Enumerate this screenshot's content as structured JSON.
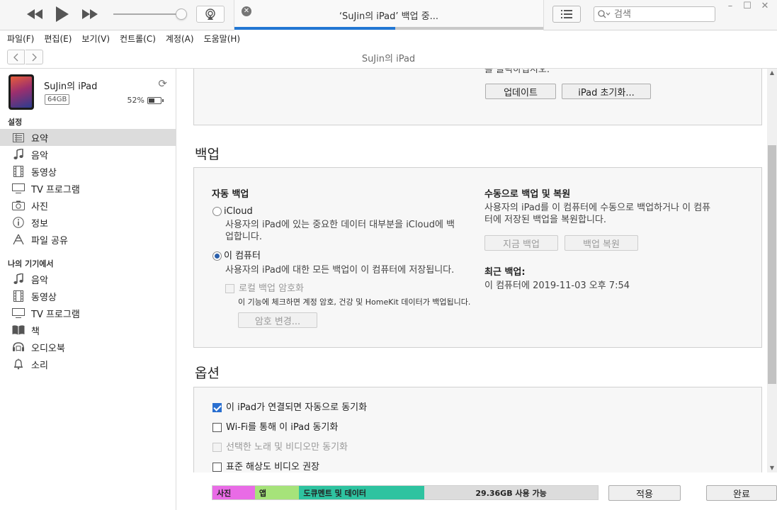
{
  "player": {
    "lcd_title": "‘SuJin의 iPad’ 백업 중...",
    "progress": 0.52,
    "search_placeholder": "검색"
  },
  "window_controls": {
    "minimize": "–",
    "maximize": "☐",
    "close": "✕"
  },
  "menubar": [
    "파일(F)",
    "편집(E)",
    "보기(V)",
    "컨트롤(C)",
    "계정(A)",
    "도움말(H)"
  ],
  "nav": {
    "device_title": "SuJin의 iPad"
  },
  "device": {
    "name": "SuJin의 iPad",
    "capacity": "64GB",
    "battery": "52%",
    "battery_level": 0.52
  },
  "sidebar": {
    "settings_header": "설정",
    "settings_items": [
      {
        "label": "요약",
        "icon": "summary-icon",
        "selected": true
      },
      {
        "label": "음악",
        "icon": "music-note-icon"
      },
      {
        "label": "동영상",
        "icon": "film-icon"
      },
      {
        "label": "TV 프로그램",
        "icon": "tv-icon"
      },
      {
        "label": "사진",
        "icon": "camera-icon"
      },
      {
        "label": "정보",
        "icon": "info-icon"
      },
      {
        "label": "파일 공유",
        "icon": "app-share-icon"
      }
    ],
    "ondevice_header": "나의 기기에서",
    "ondevice_items": [
      {
        "label": "음악",
        "icon": "music-note-icon"
      },
      {
        "label": "동영상",
        "icon": "film-icon"
      },
      {
        "label": "TV 프로그램",
        "icon": "tv-icon"
      },
      {
        "label": "책",
        "icon": "book-icon"
      },
      {
        "label": "오디오북",
        "icon": "audiobook-icon"
      },
      {
        "label": "소리",
        "icon": "bell-icon"
      }
    ]
  },
  "top_panel": {
    "partial_text": "를 클릭하십시오.",
    "update_button": "업데이트",
    "restore_button": "iPad 초기화..."
  },
  "backup": {
    "heading": "백업",
    "auto_title": "자동 백업",
    "icloud_label": "iCloud",
    "icloud_desc_1": "사용자의 iPad에 있는 중요한 데이터 대부분을 iCloud에 백",
    "icloud_desc_2": "업합니다.",
    "computer_label": "이 컴퓨터",
    "computer_desc": "사용자의 iPad에 대한 모든 백업이 이 컴퓨터에 저장됩니다.",
    "encrypt_label": "로컬 백업 암호화",
    "encrypt_desc": "이 기능에 체크하면 계정 암호, 건강 및 HomeKit 데이터가 백업됩니다.",
    "change_pw_button": "암호 변경...",
    "manual_title": "수동으로 백업 및 복원",
    "manual_desc_1": "사용자의 iPad를 이 컴퓨터에 수동으로 백업하거나 이 컴퓨",
    "manual_desc_2": "터에 저장된 백업을 복원합니다.",
    "backup_now_button": "지금 백업",
    "restore_backup_button": "백업 복원",
    "latest_title": "최근 백업:",
    "latest_value": "이 컴퓨터에 2019-11-03 오후 7:54"
  },
  "options": {
    "heading": "옵션",
    "items": [
      {
        "label": "이 iPad가 연결되면 자동으로 동기화",
        "checked": true,
        "disabled": false
      },
      {
        "label": "Wi-Fi를 통해 이 iPad 동기화",
        "checked": false,
        "disabled": false
      },
      {
        "label": "선택한 노래 및 비디오만 동기화",
        "checked": false,
        "disabled": true
      },
      {
        "label": "표준 해상도 비디오 권장",
        "checked": false,
        "disabled": false
      }
    ]
  },
  "storage": {
    "segments": [
      {
        "label": "사진",
        "color": "#e96be6",
        "share": 0.11
      },
      {
        "label": "앱",
        "color": "#a6e37a",
        "share": 0.115
      },
      {
        "label": "도큐멘트 및 데이터",
        "color": "#2ec3a0",
        "share": 0.325
      }
    ],
    "free_label": "29.36GB 사용 가능",
    "free_color": "#dcdcdc"
  },
  "footer": {
    "apply_button": "적용",
    "done_button": "완료"
  }
}
